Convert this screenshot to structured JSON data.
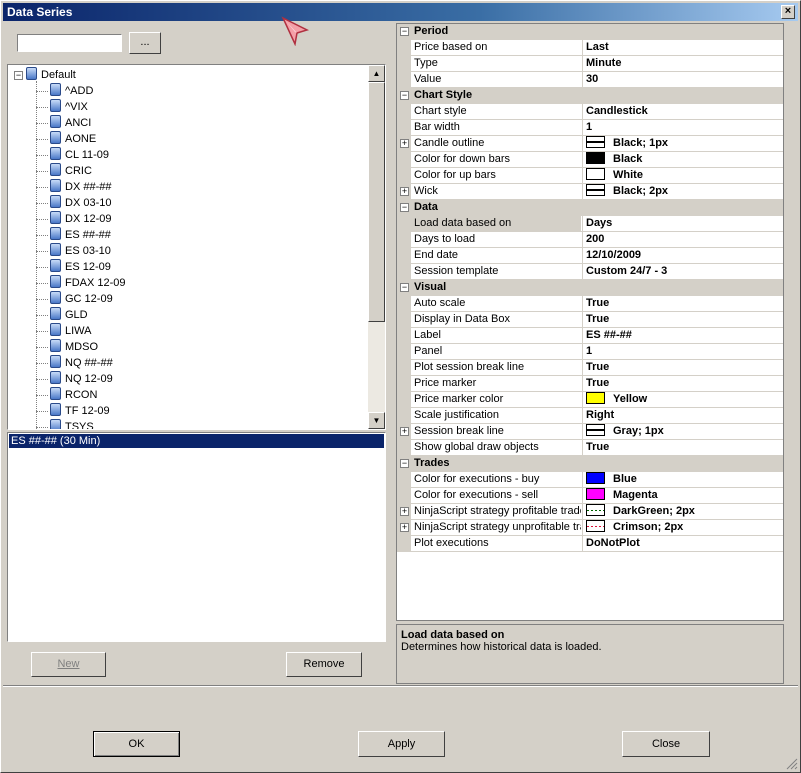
{
  "window": {
    "title": "Data Series",
    "close": "×"
  },
  "search": {
    "value": "",
    "browse_label": "..."
  },
  "tree": {
    "root": "Default",
    "items": [
      "^ADD",
      "^VIX",
      "ANCI",
      "AONE",
      "CL 11-09",
      "CRIC",
      "DX ##-##",
      "DX 03-10",
      "DX 12-09",
      "ES ##-##",
      "ES 03-10",
      "ES 12-09",
      "FDAX 12-09",
      "GC 12-09",
      "GLD",
      "LIWA",
      "MDSO",
      "NQ ##-##",
      "NQ 12-09",
      "RCON",
      "TF 12-09",
      "TSYS"
    ]
  },
  "series_list": {
    "items": [
      "ES ##-## (30 Min)"
    ]
  },
  "buttons": {
    "new": "New",
    "remove": "Remove",
    "ok": "OK",
    "apply": "Apply",
    "close": "Close"
  },
  "properties": [
    {
      "type": "cat",
      "label": "Period"
    },
    {
      "type": "prop",
      "name": "Price based on",
      "value": "Last"
    },
    {
      "type": "prop",
      "name": "Type",
      "value": "Minute"
    },
    {
      "type": "prop",
      "name": "Value",
      "value": "30"
    },
    {
      "type": "cat",
      "label": "Chart Style"
    },
    {
      "type": "prop",
      "name": "Chart style",
      "value": "Candlestick"
    },
    {
      "type": "prop",
      "name": "Bar width",
      "value": "1"
    },
    {
      "type": "prop",
      "name": "Candle outline",
      "value": "Black; 1px",
      "expand": true,
      "swatch": "line"
    },
    {
      "type": "prop",
      "name": "Color for down bars",
      "value": "Black",
      "swatch": "#000000"
    },
    {
      "type": "prop",
      "name": "Color for up bars",
      "value": "White",
      "swatch": "#ffffff"
    },
    {
      "type": "prop",
      "name": "Wick",
      "value": "Black; 2px",
      "expand": true,
      "swatch": "line"
    },
    {
      "type": "cat",
      "label": "Data"
    },
    {
      "type": "prop",
      "name": "Load data based on",
      "value": "Days",
      "selected": true
    },
    {
      "type": "prop",
      "name": "Days to load",
      "value": "200"
    },
    {
      "type": "prop",
      "name": "End date",
      "value": "12/10/2009"
    },
    {
      "type": "prop",
      "name": "Session template",
      "value": "Custom 24/7 - 3"
    },
    {
      "type": "cat",
      "label": "Visual"
    },
    {
      "type": "prop",
      "name": "Auto scale",
      "value": "True"
    },
    {
      "type": "prop",
      "name": "Display in Data Box",
      "value": "True"
    },
    {
      "type": "prop",
      "name": "Label",
      "value": "ES ##-##"
    },
    {
      "type": "prop",
      "name": "Panel",
      "value": "1"
    },
    {
      "type": "prop",
      "name": "Plot session break line",
      "value": "True"
    },
    {
      "type": "prop",
      "name": "Price marker",
      "value": "True"
    },
    {
      "type": "prop",
      "name": "Price marker color",
      "value": "Yellow",
      "swatch": "#ffff00"
    },
    {
      "type": "prop",
      "name": "Scale justification",
      "value": "Right"
    },
    {
      "type": "prop",
      "name": "Session break line",
      "value": "Gray; 1px",
      "expand": true,
      "swatch": "line"
    },
    {
      "type": "prop",
      "name": "Show global draw objects",
      "value": "True"
    },
    {
      "type": "cat",
      "label": "Trades"
    },
    {
      "type": "prop",
      "name": "Color for executions - buy",
      "value": "Blue",
      "swatch": "#0000ff"
    },
    {
      "type": "prop",
      "name": "Color for executions - sell",
      "value": "Magenta",
      "swatch": "#ff00ff"
    },
    {
      "type": "prop",
      "name": "NinjaScript strategy profitable trade",
      "value": "DarkGreen; 2px",
      "expand": true,
      "swatch": "dotgreen"
    },
    {
      "type": "prop",
      "name": "NinjaScript strategy unprofitable tra",
      "value": "Crimson; 2px",
      "expand": true,
      "swatch": "dotred"
    },
    {
      "type": "prop",
      "name": "Plot executions",
      "value": "DoNotPlot"
    }
  ],
  "description": {
    "title": "Load data based on",
    "text": "Determines how historical data is loaded."
  }
}
